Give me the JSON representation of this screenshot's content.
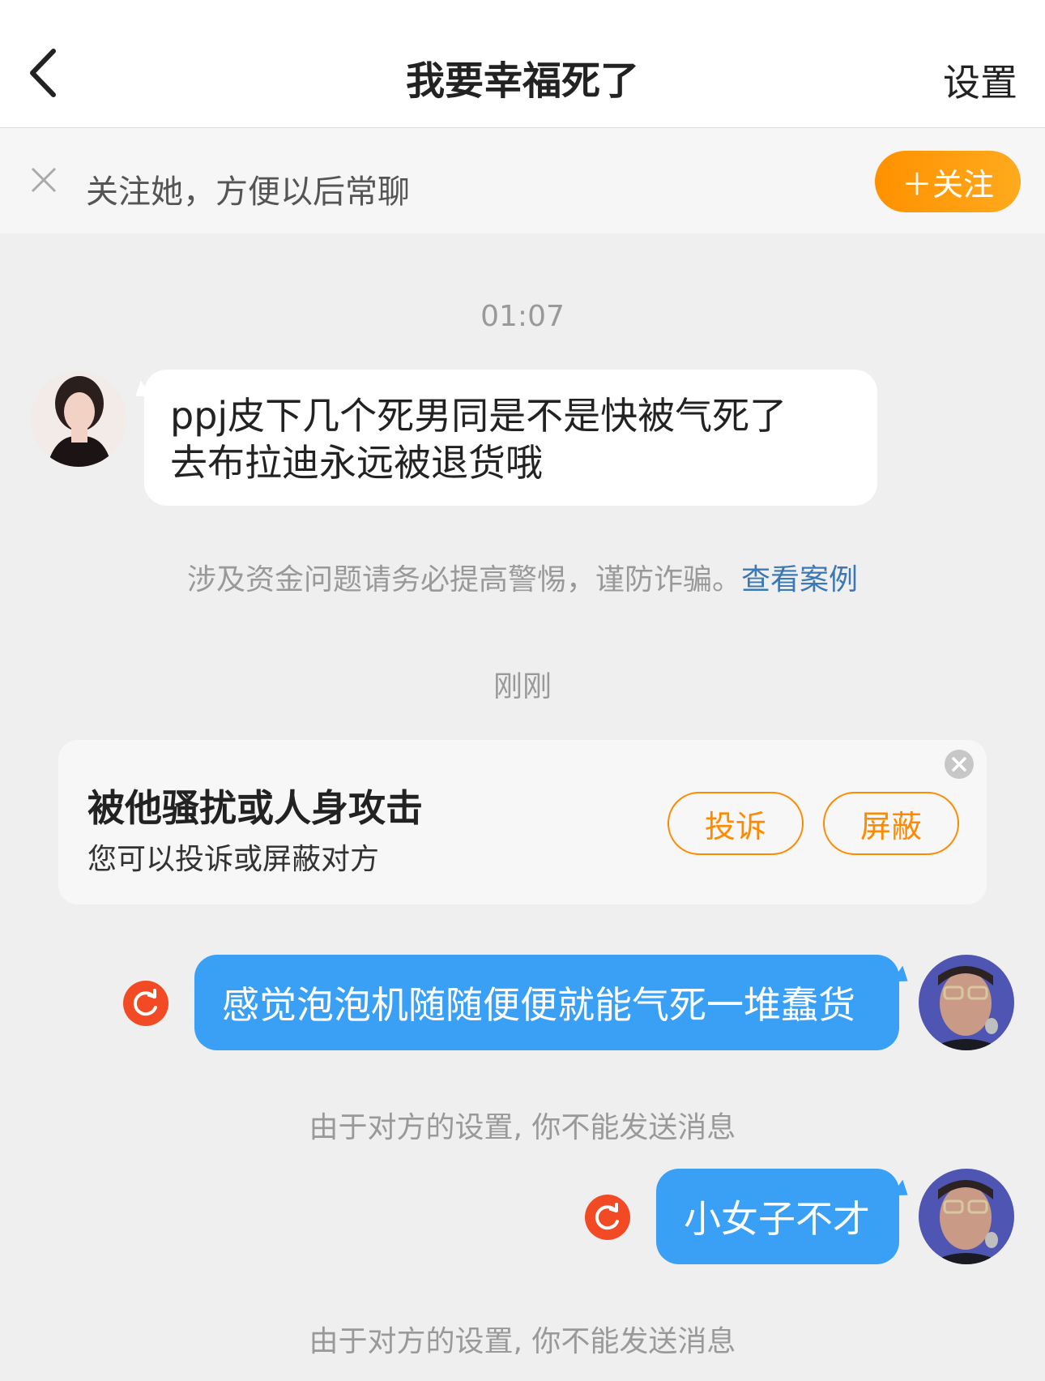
{
  "header": {
    "title": "我要幸福死了",
    "settings_label": "设置",
    "back_icon": "chevron-left-icon"
  },
  "follow_bar": {
    "text": "关注她，方便以后常聊",
    "button_label": "＋关注",
    "accent": "#ff9100"
  },
  "messages": {
    "time1": "01:07",
    "incoming1": {
      "line1": "ppj皮下几个死男同是不是快被气死了",
      "line2": "去布拉迪永远被退货哦"
    },
    "warning": {
      "text": "涉及资金问题请务必提高警惕，谨防诈骗。",
      "link": "查看案例"
    },
    "time2": "刚刚",
    "outgoing1": "感觉泡泡机随随便便就能气死一堆蠢货",
    "note1": "由于对方的设置, 你不能发送消息",
    "outgoing2": "小女子不才",
    "note2": "由于对方的设置, 你不能发送消息"
  },
  "harass_card": {
    "title": "被他骚扰或人身攻击",
    "subtitle": "您可以投诉或屏蔽对方",
    "report_label": "投诉",
    "block_label": "屏蔽"
  },
  "colors": {
    "bubble_out": "#3aa0f6",
    "retry": "#f24a24",
    "link": "#3b78b6"
  }
}
